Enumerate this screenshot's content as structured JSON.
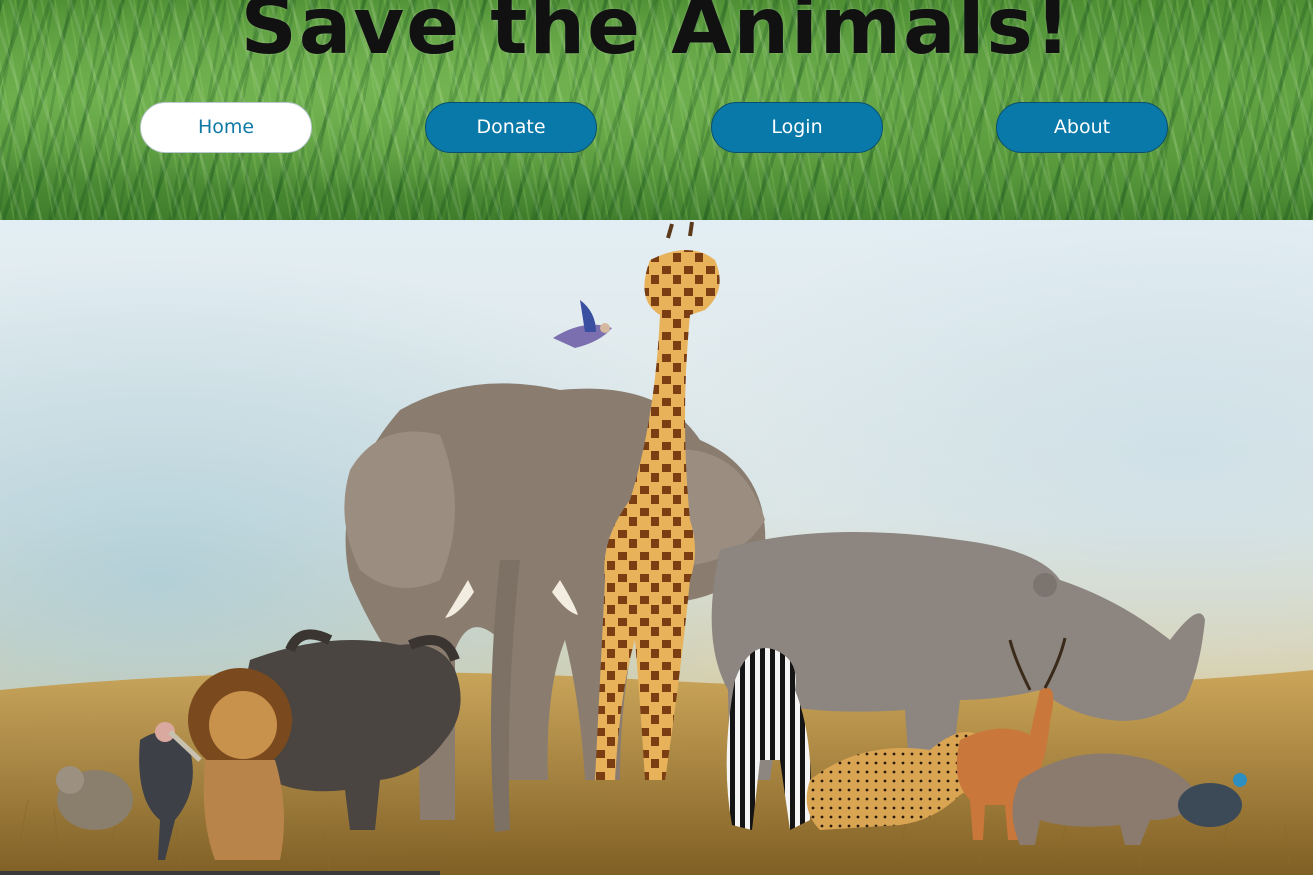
{
  "header": {
    "title": "Save the Animals!"
  },
  "nav": {
    "items": [
      {
        "label": "Home",
        "active": true
      },
      {
        "label": "Donate",
        "active": false
      },
      {
        "label": "Login",
        "active": false
      },
      {
        "label": "About",
        "active": false
      }
    ]
  },
  "colors": {
    "nav_button": "#0879a8",
    "nav_button_active": "#ffffff",
    "nav_text_active": "#0f7aa6",
    "title_text": "#111111",
    "banner_grass": "#5d9e3f"
  },
  "hero": {
    "image_subject": "african-wildlife-group-photo"
  }
}
